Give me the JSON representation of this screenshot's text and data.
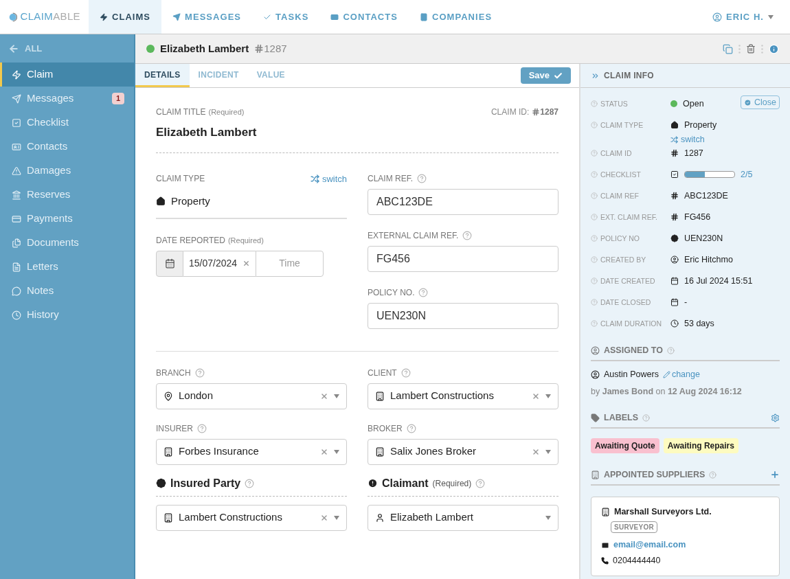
{
  "nav": {
    "logo_main": "CLAIM",
    "logo_rest": "ABLE",
    "items": [
      {
        "label": "CLAIMS",
        "selected": true
      },
      {
        "label": "MESSAGES",
        "selected": false
      },
      {
        "label": "TASKS",
        "selected": false
      },
      {
        "label": "CONTACTS",
        "selected": false
      },
      {
        "label": "COMPANIES",
        "selected": false
      }
    ],
    "user": "ERIC H."
  },
  "sidebar": {
    "back": "ALL",
    "items": [
      {
        "label": "Claim",
        "selected": true
      },
      {
        "label": "Messages",
        "selected": false,
        "badge": "1"
      },
      {
        "label": "Checklist",
        "selected": false
      },
      {
        "label": "Contacts",
        "selected": false
      },
      {
        "label": "Damages",
        "selected": false
      },
      {
        "label": "Reserves",
        "selected": false
      },
      {
        "label": "Payments",
        "selected": false
      },
      {
        "label": "Documents",
        "selected": false
      },
      {
        "label": "Letters",
        "selected": false
      },
      {
        "label": "Notes",
        "selected": false
      },
      {
        "label": "History",
        "selected": false
      }
    ]
  },
  "header": {
    "title": "Elizabeth Lambert",
    "number": "1287"
  },
  "tabs": [
    {
      "label": "DETAILS",
      "selected": true
    },
    {
      "label": "INCIDENT",
      "selected": false
    },
    {
      "label": "VALUE",
      "selected": false
    }
  ],
  "save_button": "Save",
  "form": {
    "title_label": "CLAIM TITLE",
    "title_required": "(Required)",
    "title_value": "Elizabeth Lambert",
    "claim_id_label": "CLAIM ID:",
    "claim_id": "1287",
    "claim_type": {
      "label": "CLAIM TYPE",
      "switch": "switch",
      "value": "Property"
    },
    "date_reported": {
      "label": "DATE REPORTED",
      "required": "(Required)",
      "value": "15/07/2024",
      "time_placeholder": "Time"
    },
    "refs": [
      {
        "label": "CLAIM REF.",
        "value": "ABC123DE"
      },
      {
        "label": "EXTERNAL CLAIM REF.",
        "value": "FG456"
      },
      {
        "label": "POLICY NO.",
        "value": "UEN230N"
      }
    ],
    "selects": [
      {
        "label": "BRANCH",
        "value": "London",
        "kind": "location"
      },
      {
        "label": "CLIENT",
        "value": "Lambert Constructions",
        "kind": "company"
      },
      {
        "label": "INSURER",
        "value": "Forbes Insurance",
        "kind": "company"
      },
      {
        "label": "BROKER",
        "value": "Salix Jones Broker",
        "kind": "company"
      }
    ],
    "parties": [
      {
        "heading": "Insured Party",
        "value": "Lambert Constructions",
        "kind": "company",
        "clearable": true
      },
      {
        "heading": "Claimant",
        "required": "(Required)",
        "value": "Elizabeth Lambert",
        "kind": "person",
        "clearable": false
      }
    ]
  },
  "info": {
    "title": "CLAIM INFO",
    "rows": [
      {
        "label": "STATUS",
        "value": "Open",
        "kind": "status",
        "button": "Close"
      },
      {
        "label": "CLAIM TYPE",
        "value": "Property",
        "kind": "type",
        "link": "switch"
      },
      {
        "label": "CLAIM ID",
        "value": "1287",
        "kind": "hash"
      },
      {
        "label": "CHECKLIST",
        "value": "2/5",
        "kind": "checklist",
        "level": 0.4
      },
      {
        "label": "CLAIM REF",
        "value": "ABC123DE",
        "kind": "hash"
      },
      {
        "label": "EXT. CLAIM REF.",
        "value": "FG456",
        "kind": "hash"
      },
      {
        "label": "POLICY NO",
        "value": "UEN230N",
        "kind": "policy"
      },
      {
        "label": "CREATED BY",
        "value": "Eric Hitchmo",
        "kind": "person"
      },
      {
        "label": "DATE CREATED",
        "value": "16 Jul 2024 15:51",
        "kind": "date"
      },
      {
        "label": "DATE CLOSED",
        "value": "-",
        "kind": "date"
      },
      {
        "label": "CLAIM DURATION",
        "value": "53 days",
        "kind": "duration"
      }
    ]
  },
  "assigned": {
    "heading": "ASSIGNED TO",
    "name": "Austin Powers",
    "change": "change",
    "by": "by **James Bond** on **12 Aug 2024 16:12**"
  },
  "labels": {
    "heading": "LABELS",
    "items": [
      {
        "text": "Awaiting Quote",
        "color": "#f9c0cf"
      },
      {
        "text": "Awaiting Repairs",
        "color": "#fdfbc0"
      }
    ]
  },
  "suppliers": {
    "heading": "APPOINTED SUPPLIERS",
    "cards": [
      {
        "name": "Marshall Surveyors Ltd.",
        "role": "SURVEYOR",
        "email": "email@email.com",
        "phone": "0204444440"
      }
    ]
  }
}
